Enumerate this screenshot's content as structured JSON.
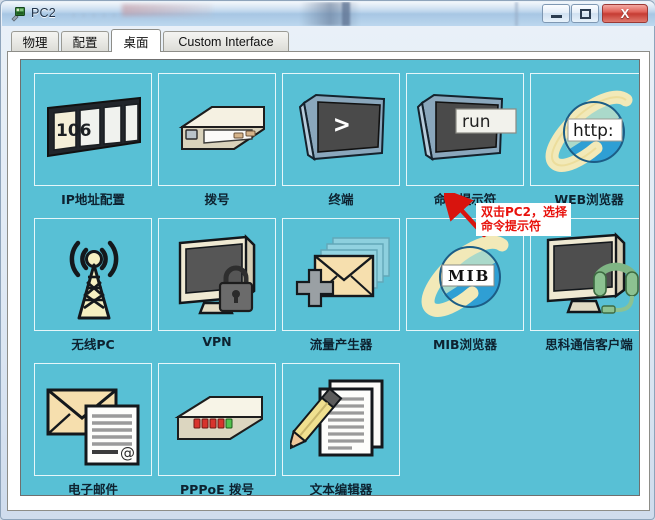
{
  "window": {
    "title": "PC2",
    "blurred_subtitle": "· · · · ·",
    "app_icon_name": "packet-tracer-pc-icon",
    "controls": {
      "minimize": "—",
      "maximize": "❐",
      "close": "X"
    }
  },
  "tabs": [
    {
      "label": "物理",
      "active": false
    },
    {
      "label": "配置",
      "active": false
    },
    {
      "label": "桌面",
      "active": true
    },
    {
      "label": "Custom Interface",
      "active": false
    }
  ],
  "desktop": {
    "background_color": "#58c0d5",
    "icons": [
      {
        "label": "IP地址配置",
        "icon": "ip-configuration-icon",
        "badge": "106"
      },
      {
        "label": "拨号",
        "icon": "dial-up-modem-icon",
        "badge": ""
      },
      {
        "label": "终端",
        "icon": "terminal-monitor-icon",
        "badge": ">"
      },
      {
        "label": "命令提示符",
        "icon": "command-prompt-icon",
        "badge": "run"
      },
      {
        "label": "WEB浏览器",
        "icon": "web-browser-globe-icon",
        "badge": "http:"
      },
      {
        "label": "无线PC",
        "icon": "wireless-antenna-icon",
        "badge": ""
      },
      {
        "label": "VPN",
        "icon": "vpn-monitor-lock-icon",
        "badge": ""
      },
      {
        "label": "流量产生器",
        "icon": "traffic-generator-mail-icon",
        "badge": ""
      },
      {
        "label": "MIB浏览器",
        "icon": "mib-browser-globe-icon",
        "badge": "MIB"
      },
      {
        "label": "思科通信客户端",
        "icon": "cisco-ip-communicator-icon",
        "badge": ""
      },
      {
        "label": "电子邮件",
        "icon": "email-envelope-icon",
        "badge": "@"
      },
      {
        "label": "PPPoE 拨号",
        "icon": "pppoe-dialup-icon",
        "badge": ""
      },
      {
        "label": "文本编辑器",
        "icon": "text-editor-pencil-icon",
        "badge": ""
      }
    ]
  },
  "annotation": {
    "line1": "双击PC2，选择",
    "line2": "命令提示符",
    "color": "#e8120c",
    "arrow": "red-arrow-pointing-up-left"
  }
}
